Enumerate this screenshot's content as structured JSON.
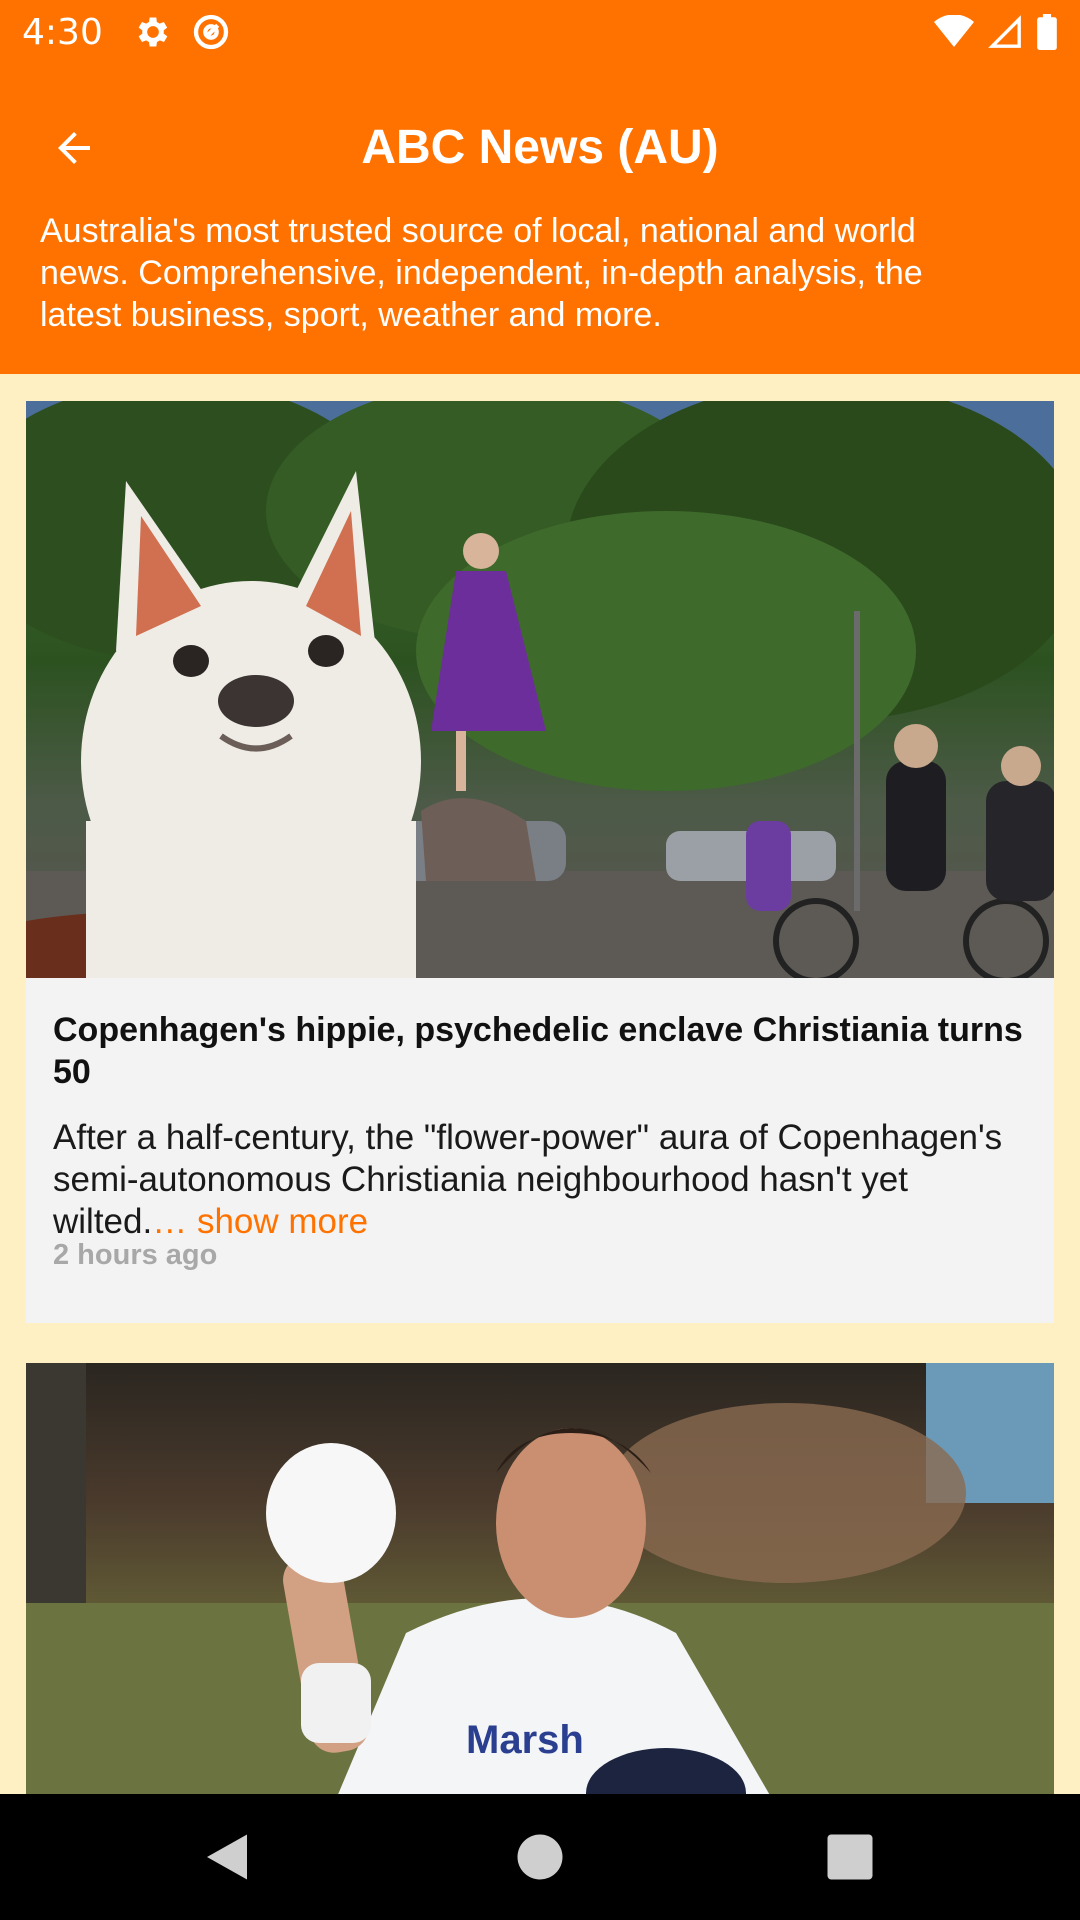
{
  "status_bar": {
    "time": "4:30",
    "icons": [
      "gear-icon",
      "at-sign-icon",
      "wifi-icon",
      "signal-icon",
      "battery-icon"
    ]
  },
  "app_bar": {
    "title": "ABC News (AU)",
    "description": "Australia's most trusted source of local, national and world news. Comprehensive, independent, in-depth analysis, the latest business, sport, weather and more.",
    "accent_color": "#ff7200"
  },
  "feed": {
    "background_color": "#fff0c4",
    "articles": [
      {
        "headline": "Copenhagen's hippie, psychedelic enclave Christiania turns 50",
        "summary": "After a half-century, the \"flower-power\" aura of Copenhagen's semi-autonomous Christiania neighbourhood hasn't yet wilted.",
        "show_more": "… show more",
        "time_ago": "2 hours ago"
      },
      {
        "headline": "",
        "summary": "",
        "image_text": "Marsh"
      }
    ]
  },
  "nav_bar": {
    "icons": [
      "back-triangle-icon",
      "home-circle-icon",
      "recents-square-icon"
    ]
  }
}
